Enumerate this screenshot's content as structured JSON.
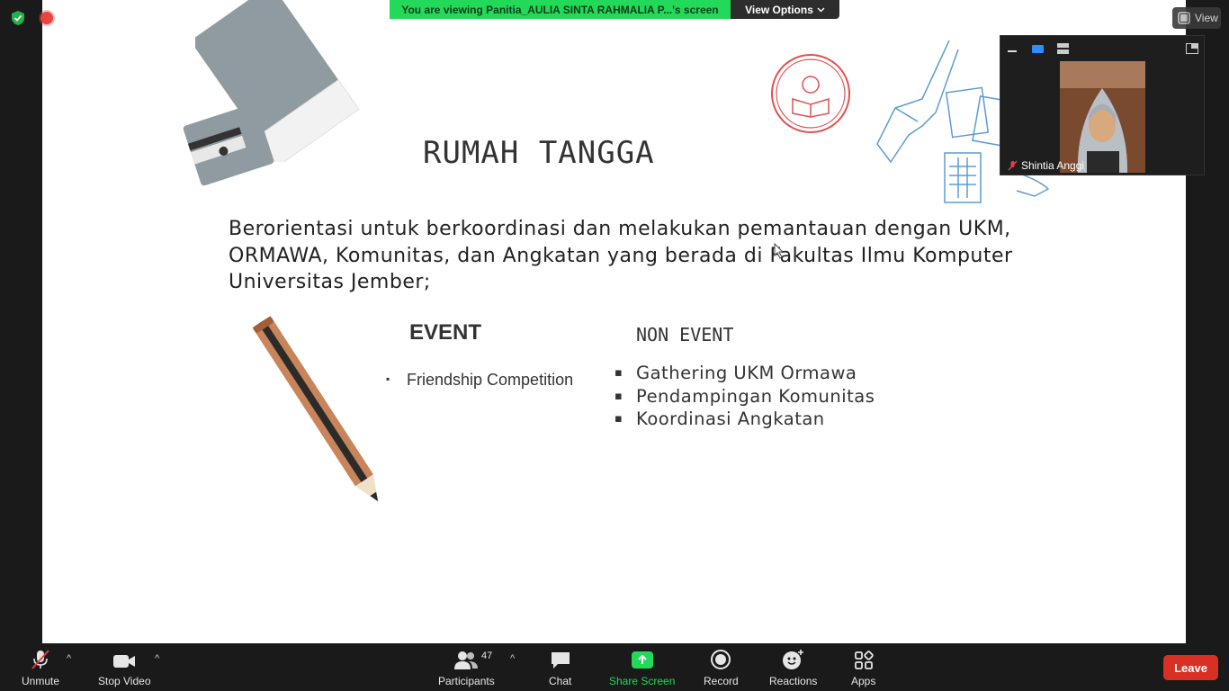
{
  "meeting": {
    "share_banner_text": "You are viewing Panitia_AULIA SINTA RAHMALIA P...'s screen",
    "view_options_label": "View Options",
    "view_label": "View"
  },
  "slide": {
    "title": "RUMAH TANGGA",
    "description": "Berorientasi untuk berkoordinasi dan melakukan pemantauan dengan UKM, ORMAWA, Komunitas, dan Angkatan yang berada di Fakultas Ilmu Komputer Universitas Jember;",
    "event_heading": "EVENT",
    "event_items": [
      "Friendship Competition"
    ],
    "nonevent_heading": "NON EVENT",
    "nonevent_items": [
      "Gathering UKM Ormawa",
      "Pendampingan Komunitas",
      "Koordinasi Angkatan"
    ]
  },
  "video_panel": {
    "participant_name": "Shintia Anggi",
    "muted_icon": "mic-muted-icon"
  },
  "toolbar": {
    "unmute_label": "Unmute",
    "stop_video_label": "Stop Video",
    "participants_label": "Participants",
    "participants_count": "47",
    "chat_label": "Chat",
    "share_screen_label": "Share Screen",
    "record_label": "Record",
    "reactions_label": "Reactions",
    "apps_label": "Apps",
    "leave_label": "Leave"
  },
  "colors": {
    "share_green": "#23d959",
    "leave_red": "#d93025",
    "toolbar_bg": "#1a1a1a"
  }
}
